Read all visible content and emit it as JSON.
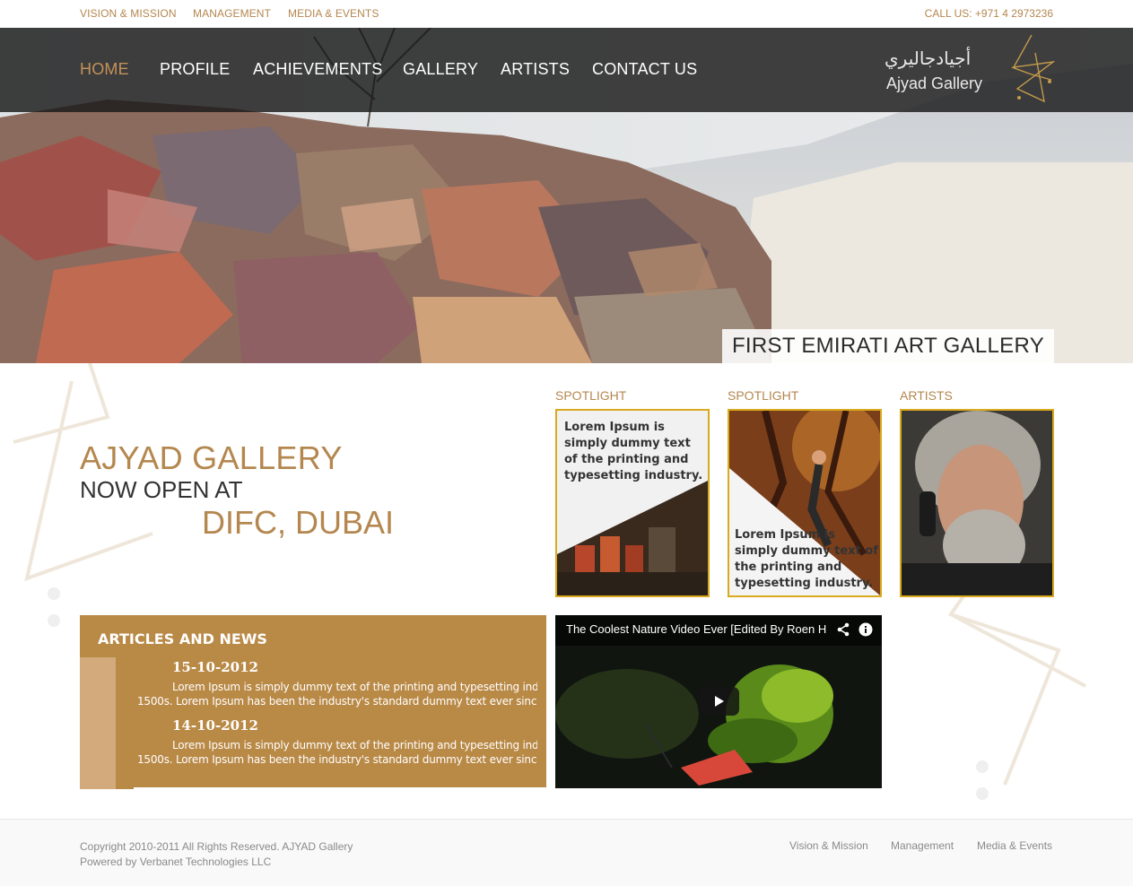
{
  "topbar": {
    "links": [
      "VISION & MISSION",
      "MANAGEMENT",
      "MEDIA & EVENTS"
    ],
    "call": "CALL US: +971 4 2973236"
  },
  "nav": {
    "items": [
      "HOME",
      "PROFILE",
      "ACHIEVEMENTS",
      "GALLERY",
      "ARTISTS",
      "CONTACT US"
    ],
    "active": "HOME"
  },
  "logo": {
    "arabic": "أجيادجاليري",
    "english": "Ajyad Gallery"
  },
  "hero": {
    "caption": "FIRST EMIRATI ART GALLERY"
  },
  "headline": {
    "line1": "AJYAD GALLERY",
    "line2": "NOW OPEN AT",
    "line3": "DIFC, DUBAI"
  },
  "cards": [
    {
      "title": "SPOTLIGHT",
      "text": "Lorem Ipsum is simply dummy text of the printing and typesetting industry."
    },
    {
      "title": "SPOTLIGHT",
      "text": "Lorem Ipsum is simply dummy text of the printing and typesetting industry."
    },
    {
      "title": "ARTISTS"
    }
  ],
  "news": {
    "title": "ARTICLES AND NEWS",
    "items": [
      {
        "date": "15-10-2012",
        "line1": "Lorem Ipsum is simply dummy text of the printing and typesetting industry",
        "line2": "1500s. Lorem Ipsum has been the industry's standard dummy text ever since the"
      },
      {
        "date": "14-10-2012",
        "line1": "Lorem Ipsum is simply dummy text of the printing and typesetting industry",
        "line2": "1500s. Lorem Ipsum has been the industry's standard dummy text ever since the"
      }
    ]
  },
  "video": {
    "title": "The Coolest Nature Video Ever [Edited By Roen H"
  },
  "footer": {
    "copyright": "Copyright 2010-2011 All Rights Reserved. AJYAD Gallery",
    "powered": "Powered by Verbanet Technologies LLC",
    "links": [
      "Vision & Mission",
      "Management",
      "Media & Events"
    ]
  },
  "colors": {
    "accent": "#b4874f",
    "news_bg": "#b98946",
    "card_border": "#d9a91e",
    "nav_bg": "#191919"
  }
}
